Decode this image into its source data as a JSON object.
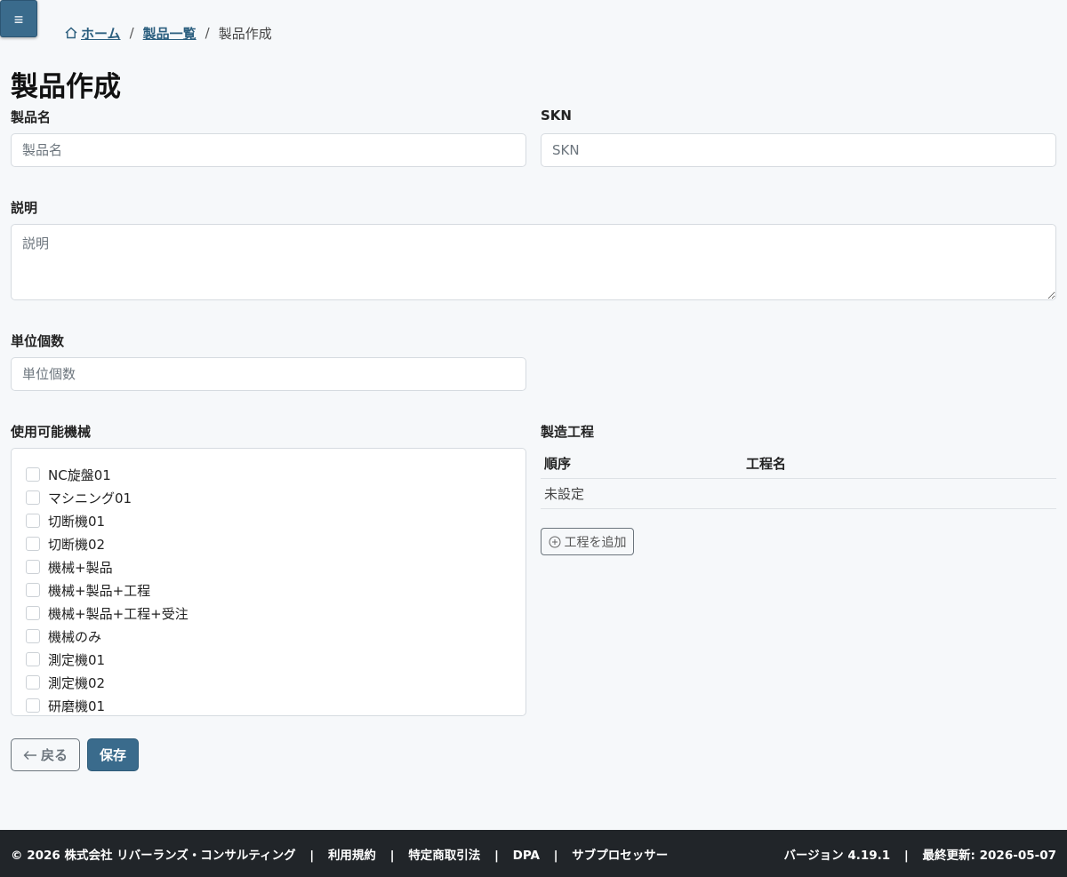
{
  "menu": {
    "icon": "hamburger-icon",
    "glyph": "≡"
  },
  "breadcrumb": {
    "home": "ホーム",
    "products": "製品一覧",
    "current": "製品作成",
    "separator": "/"
  },
  "page_title": "製品作成",
  "form": {
    "product_name": {
      "label": "製品名",
      "placeholder": "製品名",
      "value": ""
    },
    "skn": {
      "label": "SKN",
      "placeholder": "SKN",
      "value": ""
    },
    "description": {
      "label": "説明",
      "placeholder": "説明",
      "value": ""
    },
    "unit_count": {
      "label": "単位個数",
      "placeholder": "単位個数",
      "value": ""
    },
    "machines": {
      "label": "使用可能機械",
      "items": [
        {
          "label": "NC旋盤01",
          "checked": false
        },
        {
          "label": "マシニング01",
          "checked": false
        },
        {
          "label": "切断機01",
          "checked": false
        },
        {
          "label": "切断機02",
          "checked": false
        },
        {
          "label": "機械+製品",
          "checked": false
        },
        {
          "label": "機械+製品+工程",
          "checked": false
        },
        {
          "label": "機械+製品+工程+受注",
          "checked": false
        },
        {
          "label": "機械のみ",
          "checked": false
        },
        {
          "label": "測定機01",
          "checked": false
        },
        {
          "label": "測定機02",
          "checked": false
        },
        {
          "label": "研磨機01",
          "checked": false
        }
      ]
    },
    "processes": {
      "label": "製造工程",
      "col_order": "順序",
      "col_name": "工程名",
      "empty_text": "未設定",
      "add_label": "工程を追加"
    }
  },
  "actions": {
    "back_label": "戻る",
    "save_label": "保存"
  },
  "footer": {
    "copyright": "© 2026 株式会社 リバーランズ・コンサルティング",
    "links": [
      "利用規約",
      "特定商取引法",
      "DPA",
      "サブプロセッサー"
    ],
    "separator": "|",
    "version": "バージョン 4.19.1",
    "last_updated": "最終更新: 2026-05-07"
  },
  "colors": {
    "primary": "#3a6b8c",
    "footer_bg": "#212529",
    "page_bg": "#f6f8fa",
    "link": "#2c5f7f"
  }
}
